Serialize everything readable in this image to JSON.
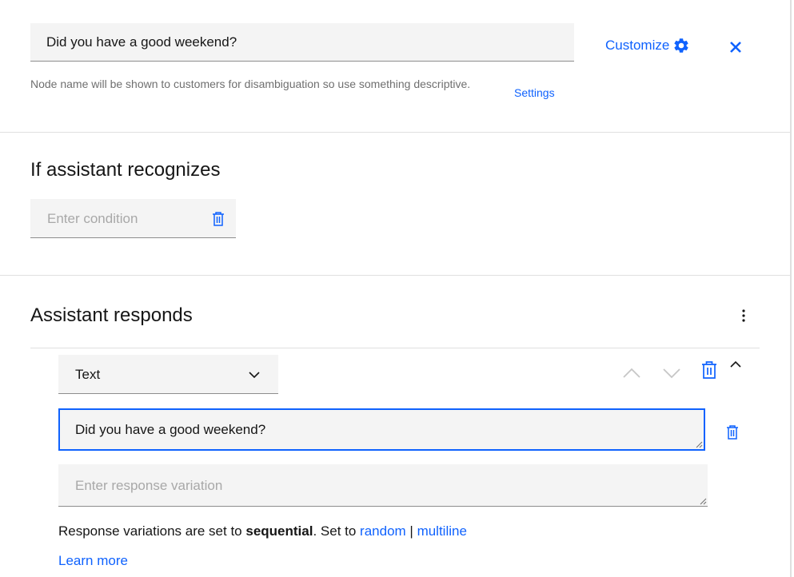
{
  "node": {
    "name_value": "Did you have a good weekend?",
    "helper_text": "Node name will be shown to customers for disambiguation so use something descriptive.",
    "settings_label": "Settings",
    "customize_label": "Customize"
  },
  "condition_section": {
    "title": "If assistant recognizes",
    "placeholder": "Enter condition"
  },
  "response_section": {
    "title": "Assistant responds",
    "type_select_value": "Text",
    "responses": [
      "Did you have a good weekend?"
    ],
    "variation_placeholder": "Enter response variation",
    "variation_prefix": "Response variations are set to ",
    "variation_mode": "sequential",
    "variation_mid": ". Set to ",
    "random_label": "random",
    "separator": " | ",
    "multiline_label": "multiline",
    "learn_more_label": "Learn more"
  },
  "colors": {
    "accent": "#0f62fe",
    "field_bg": "#f4f4f4",
    "placeholder": "#a8a8a8",
    "disabled_icon": "#c6c6c6"
  },
  "icons": [
    "gear-icon",
    "close-icon",
    "trash-icon",
    "overflow-menu-icon",
    "chevron-down-icon",
    "chevron-up-icon",
    "resize-handle-icon"
  ]
}
